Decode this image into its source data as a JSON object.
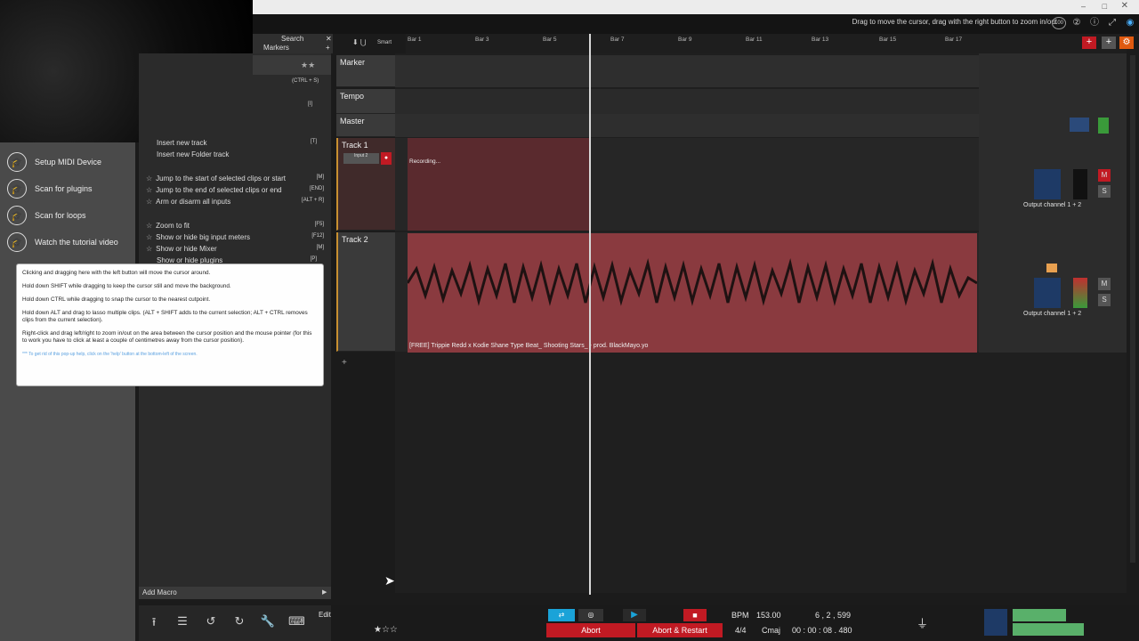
{
  "header": {
    "hint": "Drag to move the cursor, drag with the right button to zoom in/out",
    "zoom_level": "100",
    "search_label": "Search",
    "markers_label": "Markers",
    "smart_label": "Smart"
  },
  "sidebar": {
    "items": [
      {
        "label": "Setup MIDI Device",
        "icon": "midi-icon"
      },
      {
        "label": "Scan for plugins",
        "icon": "plugin-icon"
      },
      {
        "label": "Scan for loops",
        "icon": "loop-icon"
      },
      {
        "label": "Watch the tutorial video",
        "icon": "video-icon"
      }
    ]
  },
  "shortcuts": {
    "top_key_1": "(CTRL + S)",
    "top_key_2": "[I]",
    "rows": [
      {
        "label": "Insert new track",
        "key": "[T]"
      },
      {
        "label": "Insert new Folder track",
        "key": ""
      },
      {
        "label": "Jump to the start of selected clips or start",
        "key": "[M]"
      },
      {
        "label": "Jump to the end of selected clips or end",
        "key": "[END]"
      },
      {
        "label": "Arm or disarm all inputs",
        "key": "[ALT + R]"
      },
      {
        "label": "Zoom to fit",
        "key": "[F5]"
      },
      {
        "label": "Show or hide big input meters",
        "key": "[F12]"
      },
      {
        "label": "Show or hide Mixer",
        "key": "[M]"
      },
      {
        "label": "Show or hide plugins",
        "key": "[P]"
      }
    ],
    "add_macro": "Add Macro"
  },
  "tooltip": {
    "lines": [
      "Clicking and dragging here with the left button will move the cursor around.",
      "Hold down SHIFT while dragging to keep the cursor still and move the background.",
      "Hold down CTRL while dragging to snap the cursor to the nearest cutpoint.",
      "Hold down ALT and drag to lasso multiple clips. (ALT + SHIFT adds to the current selection; ALT + CTRL removes clips from the current selection).",
      "Right-click and drag left/right to zoom in/out on the area between the cursor position and the mouse pointer (for this to work you have to click at least a couple of centimetres away from the cursor position)."
    ],
    "footer": "*** To get rid of this pop-up help, click on the 'help' button at the bottom-left of the screen."
  },
  "ruler": {
    "bars": [
      "Bar 1",
      "Bar 3",
      "Bar 5",
      "Bar 7",
      "Bar 9",
      "Bar 11",
      "Bar 13",
      "Bar 15",
      "Bar 17"
    ]
  },
  "tracks": {
    "marker": "Marker",
    "tempo": "Tempo",
    "master": "Master",
    "track1": "Track 1",
    "track1_input": "Input 2",
    "track1_status": "Recording...",
    "track2": "Track 2",
    "track2_clip": "[FREE] Trippie Redd x Kodie Shane Type Beat_ Shooting Stars_ - prod. BlackMayo.yo",
    "output1": "Output channel 1 + 2",
    "output2": "Output channel 1 + 2",
    "mute": "M",
    "solo": "S"
  },
  "transport": {
    "edit_label": "Edit",
    "abort": "Abort",
    "abort_restart": "Abort & Restart",
    "bpm_label": "BPM",
    "bpm": "153.00",
    "position": "6 , 2 , 599",
    "time_sig": "4/4",
    "key": "Cmaj",
    "time": "00 : 00 : 08 . 480"
  },
  "colors": {
    "accent": "#c11a23",
    "clip": "#8a3a3f",
    "sidebar": "#4a4a4a"
  }
}
